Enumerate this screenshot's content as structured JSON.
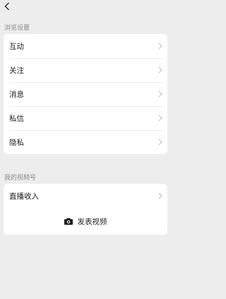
{
  "browse_section": {
    "title": "浏览设置",
    "items": [
      {
        "label": "互动"
      },
      {
        "label": "关注"
      },
      {
        "label": "消息"
      },
      {
        "label": "私信"
      },
      {
        "label": "隐私"
      }
    ]
  },
  "channel_section": {
    "title": "我的视频号",
    "income_label": "直播收入",
    "publish_label": "发表视频"
  },
  "icons": {
    "back": "chevron-left-icon",
    "row_arrow": "chevron-right-icon",
    "publish": "camera-icon"
  },
  "colors": {
    "background": "#ededed",
    "card": "#ffffff",
    "section_title": "#8a8a8a",
    "chevron": "#bdbdbd"
  }
}
